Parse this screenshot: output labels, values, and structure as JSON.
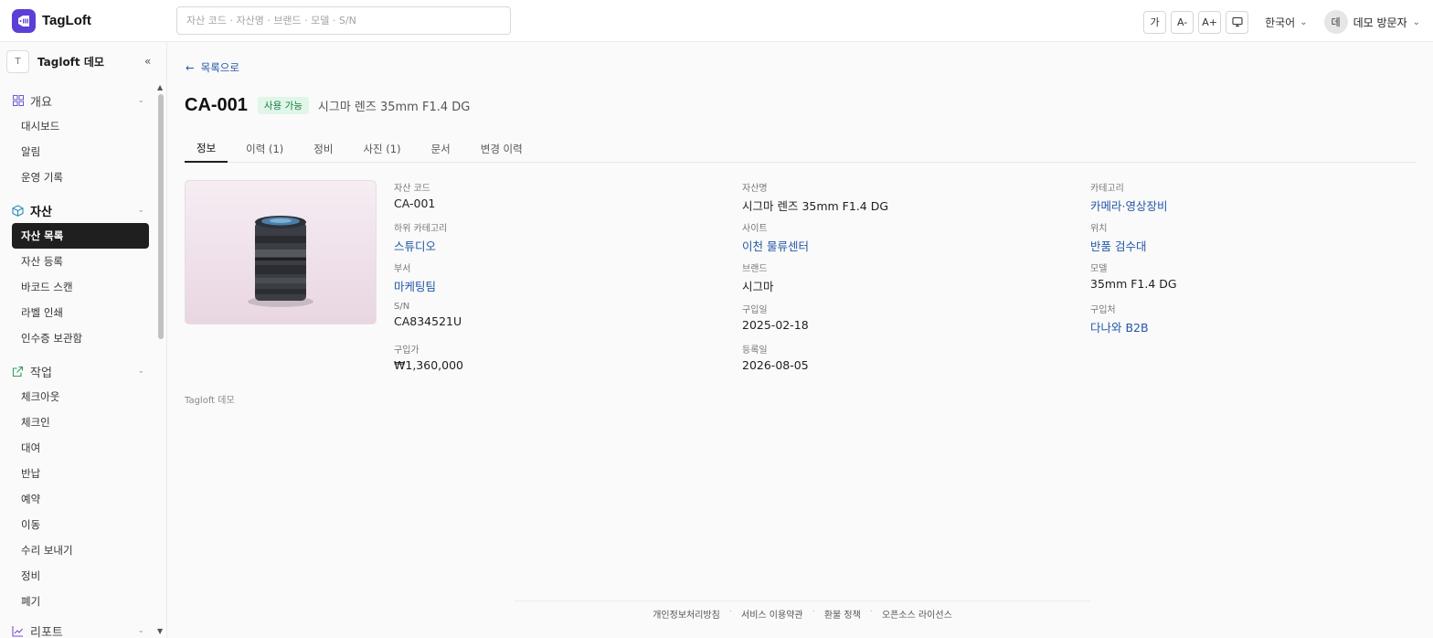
{
  "app": {
    "name": "TagLoft",
    "search_placeholder": "자산 코드 · 자산명 · 브랜드 · 모델 · S/N"
  },
  "toolbar": {
    "font_btn": "가",
    "font_smaller": "A-",
    "font_larger": "A+",
    "display_icon": "monitor-icon",
    "language": "한국어",
    "avatar_initial": "데",
    "user_name": "데모 방문자"
  },
  "sidebar": {
    "org_initial": "T",
    "org_name": "Tagloft 데모",
    "collapse_label": "«",
    "groups": [
      {
        "label": "개요",
        "icon": "grid-icon",
        "items": [
          "대시보드",
          "알림",
          "운영 기록"
        ]
      },
      {
        "label": "자산",
        "icon": "box-icon",
        "items": [
          "자산 목록",
          "자산 등록",
          "바코드 스캔",
          "라벨 인쇄",
          "인수증 보관함"
        ]
      },
      {
        "label": "작업",
        "icon": "external-link-icon",
        "items": [
          "체크아웃",
          "체크인",
          "대여",
          "반납",
          "예약",
          "이동",
          "수리 보내기",
          "정비",
          "폐기"
        ]
      },
      {
        "label": "리포트",
        "icon": "chart-icon",
        "items": []
      }
    ],
    "active_item": "자산 목록"
  },
  "detail": {
    "back_label": "목록으로",
    "code": "CA-001",
    "status": "사용 가능",
    "name": "시그마 렌즈 35mm F1.4 DG",
    "tabs": [
      "정보",
      "이력 (1)",
      "정비",
      "사진 (1)",
      "문서",
      "변경 이력"
    ],
    "active_tab": "정보",
    "fields": {
      "asset_code": {
        "label": "자산 코드",
        "value": "CA-001"
      },
      "asset_name": {
        "label": "자산명",
        "value": "시그마 렌즈 35mm F1.4 DG"
      },
      "category": {
        "label": "카테고리",
        "value": "카메라·영상장비"
      },
      "subcategory": {
        "label": "하위 카테고리",
        "value": "스튜디오"
      },
      "site": {
        "label": "사이트",
        "value": "이천 물류센터"
      },
      "location": {
        "label": "위치",
        "value": "반품 검수대"
      },
      "department": {
        "label": "부서",
        "value": "마케팅팀"
      },
      "brand": {
        "label": "브랜드",
        "value": "시그마"
      },
      "model": {
        "label": "모델",
        "value": "35mm F1.4 DG"
      },
      "serial": {
        "label": "S/N",
        "value": "CA834521U"
      },
      "purchase_date": {
        "label": "구입일",
        "value": "2025-02-18"
      },
      "vendor": {
        "label": "구입처",
        "value": "다나와 B2B"
      },
      "price": {
        "label": "구입가",
        "value": "₩1,360,000"
      },
      "registered": {
        "label": "등록일",
        "value": "2026-08-05"
      }
    },
    "org_footer": "Tagloft 데모"
  },
  "footer": {
    "links": [
      "개인정보처리방침",
      "서비스 이용약관",
      "환불 정책",
      "오픈소스 라이선스"
    ]
  }
}
